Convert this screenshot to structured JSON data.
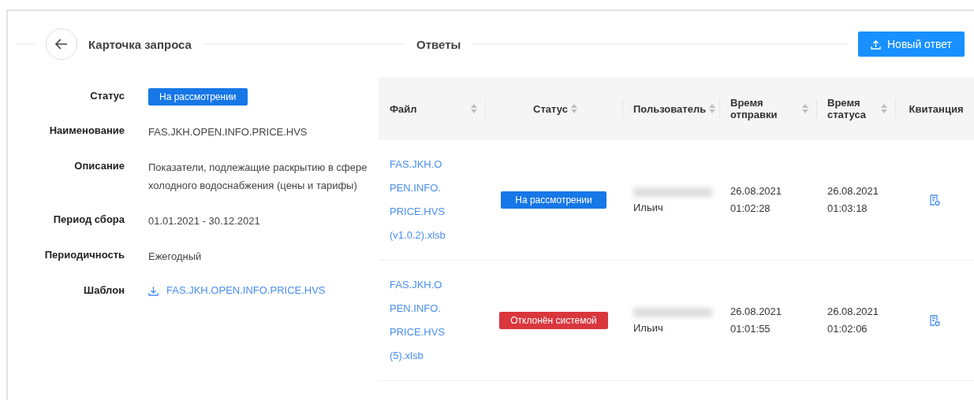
{
  "request_card": {
    "title": "Карточка запроса",
    "fields": [
      {
        "kind": "badge",
        "label": "Статус",
        "value": "На рассмотрении",
        "color": "#1677e6"
      },
      {
        "kind": "text",
        "label": "Наименование",
        "value": "FAS.JKH.OPEN.INFO.PRICE.HVS"
      },
      {
        "kind": "text",
        "label": "Описание",
        "value": "Показатели, подлежащие раскрытию в сфере холодного водоснабжения (цены и тарифы)"
      },
      {
        "kind": "text",
        "label": "Период сбора",
        "value": "01.01.2021 - 30.12.2021"
      },
      {
        "kind": "text",
        "label": "Периодичность",
        "value": "Ежегодный"
      },
      {
        "kind": "download",
        "label": "Шаблон",
        "value": "FAS.JKH.OPEN.INFO.PRICE.HVS"
      }
    ]
  },
  "answers": {
    "title": "Ответы",
    "new_button": "Новый ответ",
    "columns": [
      {
        "label": "Файл",
        "sortable": true
      },
      {
        "label": "Статус",
        "sortable": true
      },
      {
        "label": "Пользователь",
        "sortable": true
      },
      {
        "label": "Время отправки",
        "sortable": true
      },
      {
        "label": "Время статуса",
        "sortable": true
      },
      {
        "label": "Квитанция",
        "sortable": false
      }
    ],
    "rows": [
      {
        "file": "FAS.JKH.OPEN.INFO.PRICE.HVS(v1.0.2).xlsb",
        "status": "На рассмотрении",
        "color": "#1677e6",
        "user": "Ильич",
        "sent": "26.08.2021 01:02:28",
        "status_time": "26.08.2021 01:03:18"
      },
      {
        "file": "FAS.JKH.OPEN.INFO.PRICE.HVS (5).xlsb",
        "status": "Отклонён системой",
        "color": "#d9363e",
        "user": "Ильич",
        "sent": "26.08.2021 01:01:55",
        "status_time": "26.08.2021 01:02:06"
      }
    ]
  }
}
